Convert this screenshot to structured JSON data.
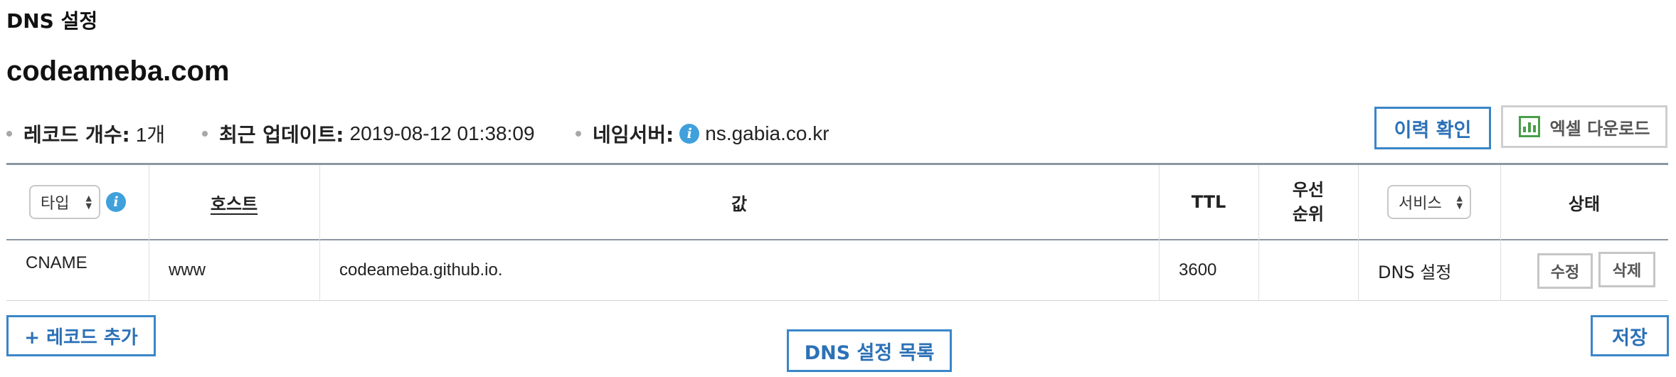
{
  "section_title": "DNS 설정",
  "domain": "codeameba.com",
  "meta": {
    "record_count_label": "레코드 개수:",
    "record_count_value": "1개",
    "updated_label": "최근 업데이트:",
    "updated_value": "2019-08-12 01:38:09",
    "nameserver_label": "네임서버:",
    "nameserver_value": "ns.gabia.co.kr"
  },
  "actions": {
    "history_label": "이력 확인",
    "excel_label": "엑셀 다운로드"
  },
  "table": {
    "headers": {
      "type_select": "타입",
      "host": "호스트",
      "value": "값",
      "ttl": "TTL",
      "priority_line1": "우선",
      "priority_line2": "순위",
      "service_select": "서비스",
      "status": "상태"
    },
    "rows": [
      {
        "type": "CNAME",
        "host": "www",
        "value": "codeameba.github.io.",
        "ttl": "3600",
        "priority": "",
        "service": "DNS 설정",
        "edit_label": "수정",
        "delete_label": "삭제"
      }
    ]
  },
  "footer": {
    "add_record_label": "+ 레코드 추가",
    "dns_list_label": "DNS 설정 목록",
    "save_label": "저장"
  },
  "colors": {
    "accent_blue": "#2b71b6",
    "info_icon": "#3fa0dc",
    "excel_green": "#4a9e4a",
    "table_rule": "#8b97a2"
  }
}
